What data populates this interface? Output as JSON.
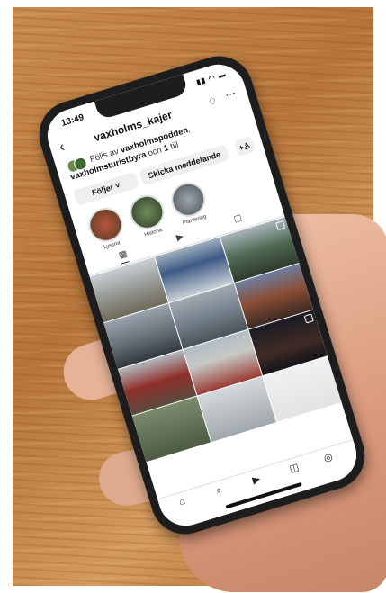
{
  "status": {
    "time": "13:49",
    "icons": "▮▮ ◠ ▬"
  },
  "profile": {
    "username": "vaxholms_kajer",
    "followed_by_prefix": "Följs av ",
    "followed_by_1": "vaxholmspodden",
    "followed_by_sep": ", ",
    "followed_by_2": "vaxholmsturistbyra",
    "followed_by_and": " och ",
    "followed_by_count": "1",
    "followed_by_suffix": " till"
  },
  "buttons": {
    "following": "Följer ˅",
    "message": "Skicka meddelande",
    "add": "+♙"
  },
  "highlights": [
    {
      "label": "Lyssna"
    },
    {
      "label": "Historia"
    },
    {
      "label": "Plantering"
    }
  ],
  "icons": {
    "back": "‹",
    "bell": "♢",
    "more": "···",
    "tab_grid": "▦",
    "tab_reels": "▶",
    "tab_tagged": "☐",
    "nav_home": "⌂",
    "nav_search": "⌕",
    "nav_reels": "▶",
    "nav_shop": "◫",
    "nav_profile": "◎"
  }
}
